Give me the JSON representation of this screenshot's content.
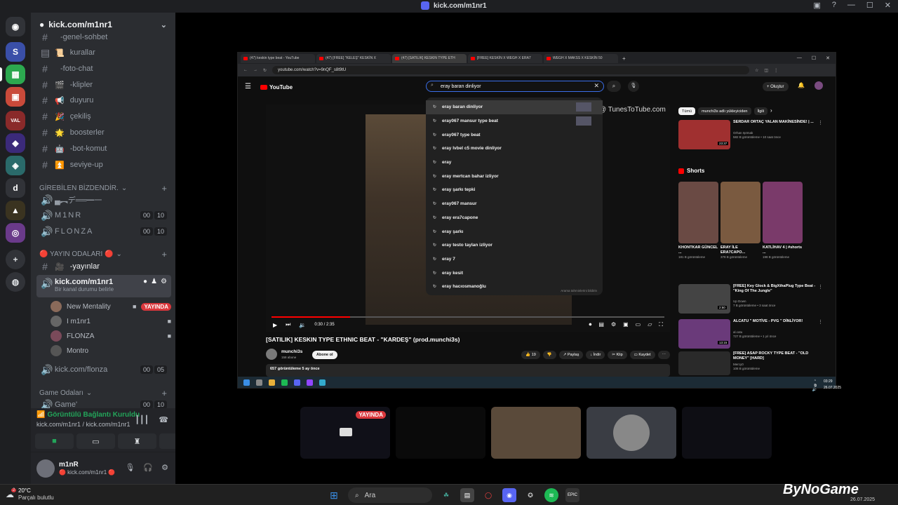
{
  "window": {
    "title": "kick.com/m1nr1"
  },
  "server": {
    "name": "kick.com/m1nr1"
  },
  "channels": [
    {
      "icon": "",
      "label": "-genel-sohbet",
      "type": "text"
    },
    {
      "icon": "📜",
      "label": "kurallar",
      "type": "rules"
    },
    {
      "icon": "",
      "label": "-foto-chat",
      "type": "text"
    },
    {
      "icon": "🎬",
      "label": "-klipler",
      "type": "text"
    },
    {
      "icon": "📢",
      "label": "duyuru",
      "type": "text"
    },
    {
      "icon": "🎉",
      "label": "çekiliş",
      "type": "text"
    },
    {
      "icon": "🌟",
      "label": "boosterler",
      "type": "text"
    },
    {
      "icon": "🤖",
      "label": "-bot-komut",
      "type": "text"
    },
    {
      "icon": "⏫",
      "label": "seviye-up",
      "type": "text"
    }
  ],
  "cat1": {
    "label": "GİREBİLEN BİZDENDİR."
  },
  "voice1": [
    {
      "label": "▄︻デ══━一",
      "c1": "",
      "c2": ""
    },
    {
      "label": "M1NR",
      "c1": "00",
      "c2": "10"
    },
    {
      "label": "FLONZA",
      "c1": "00",
      "c2": "10"
    }
  ],
  "cat2": {
    "label": "🔴 YAYIN ODALARI 🔴"
  },
  "stream_channel": {
    "label": "-yayınlar",
    "icon": "🎥"
  },
  "active_voice": {
    "label": "kick.com/m1nr1",
    "sub": "Bir kanal durumu belirle"
  },
  "voice_users": [
    {
      "name": "New Mentality",
      "live": "YAYINDA"
    },
    {
      "name": "I m1nr1",
      "live": ""
    },
    {
      "name": "FLONZA",
      "live": ""
    },
    {
      "name": "Montro",
      "live": ""
    }
  ],
  "voice2": {
    "label": "kick.com/flonza",
    "c1": "00",
    "c2": "05"
  },
  "cat3": {
    "label": "Game Odaları"
  },
  "voice3": {
    "label": "Game'",
    "c1": "00",
    "c2": "10"
  },
  "voice_panel": {
    "status": "Görüntülü Bağlantı Kuruldu",
    "channel": "kick.com/m1nr1 / kick.com/m1nr1"
  },
  "user": {
    "name": "m1nR",
    "status": "🔴 kick.com/m1nr1 🔴"
  },
  "browser": {
    "tabs": [
      "(47) keskin type beat - YouTube",
      "(47) [FREE] \"KELEŞ\" KESKİN X",
      "(47) [SATILIK] KESKIN TYPE ETH",
      "[FREE] KESKİN X WEGH X ERA7",
      "WEGH X MAKSS X KESKİN 50"
    ],
    "url": "youtube.com/watch?v=9nQF_s8t9tU",
    "logo": "YouTube",
    "search_value": "eray baran dinliyor",
    "create_label": "Oluştur"
  },
  "suggestions": [
    "eray baran dinliyor",
    "eray067 mansur type beat",
    "eray067 type beat",
    "eray lvbel c5 movie dinliyor",
    "eray",
    "eray mertcan bahar izliyor",
    "eray şarkı tepki",
    "eray067 mansur",
    "eray era7capone",
    "eray şarkı",
    "eray testo taylan izliyor",
    "eray 7",
    "eray kesit",
    "eray hacıosmanoğlu"
  ],
  "suggest_footer": "Arama tahminlerini bildirin",
  "video": {
    "watermark": "@ TunesToTube.com",
    "time": "0:30 / 2:35",
    "progress": 0.2,
    "title": "[SATILIK] KESKIN TYPE ETHNIC BEAT - \"KARDEŞ\" (prod.munchi3s)",
    "channel": "munchi3s",
    "subs": "158 abone",
    "subscribe": "Abone ol",
    "likes": "19",
    "share": "Paylaş",
    "download": "İndir",
    "clip": "Klip",
    "save": "Kaydet",
    "views": "657 görüntüleme  5 ay önce"
  },
  "chips": [
    "Tümü",
    "munchi3s adlı yükleyiciden",
    "İlgili"
  ],
  "related_top": {
    "title": "SERDAR ORTAÇ YALAN MAKİNESİNDE! | ...",
    "channel": "Orhan Işıtmak",
    "meta": "582 B görüntüleme • 10 saat önce",
    "dur": "23:37"
  },
  "shorts_label": "Shorts",
  "shorts": [
    {
      "title": "KHONTKAR GÜNCEL ...",
      "views": "181 B görüntüleme"
    },
    {
      "title": "ERAY İLE ERA7CAPO...",
      "views": "378 B görüntüleme"
    },
    {
      "title": "KATLİHAV 4 | #shorts ...",
      "views": "198 B görüntüleme"
    }
  ],
  "related": [
    {
      "title": "[FREE] Key Glock & BigXthaPlug Type Beat - \"King Of The Jungle\"",
      "channel": "Up Down",
      "meta": "7 B görüntüleme • 3 saat önce",
      "dur": "2:50"
    },
    {
      "title": "ALCATU \" MOTİVE - PVG \" DİNLİYOR!",
      "channel": "al.catu",
      "meta": "727 B görüntüleme • 1 yıl önce",
      "dur": "13:15"
    },
    {
      "title": "[FREE] ASAP ROCKY TYPE BEAT - \"OLD MONEY\" [HARD]",
      "channel": "Mercy0",
      "meta": "108 B görüntüleme",
      "dur": ""
    }
  ],
  "inner_clock": {
    "time": "03:29",
    "date": "26.07.2025"
  },
  "tiles": [
    {
      "live": "YAYINDA"
    }
  ],
  "taskbar": {
    "temp": "20°C",
    "weather": "Parçalı bulutlu",
    "search": "Ara",
    "brand": "ByNoGame",
    "date": "26.07.2025",
    "badge": "2"
  }
}
